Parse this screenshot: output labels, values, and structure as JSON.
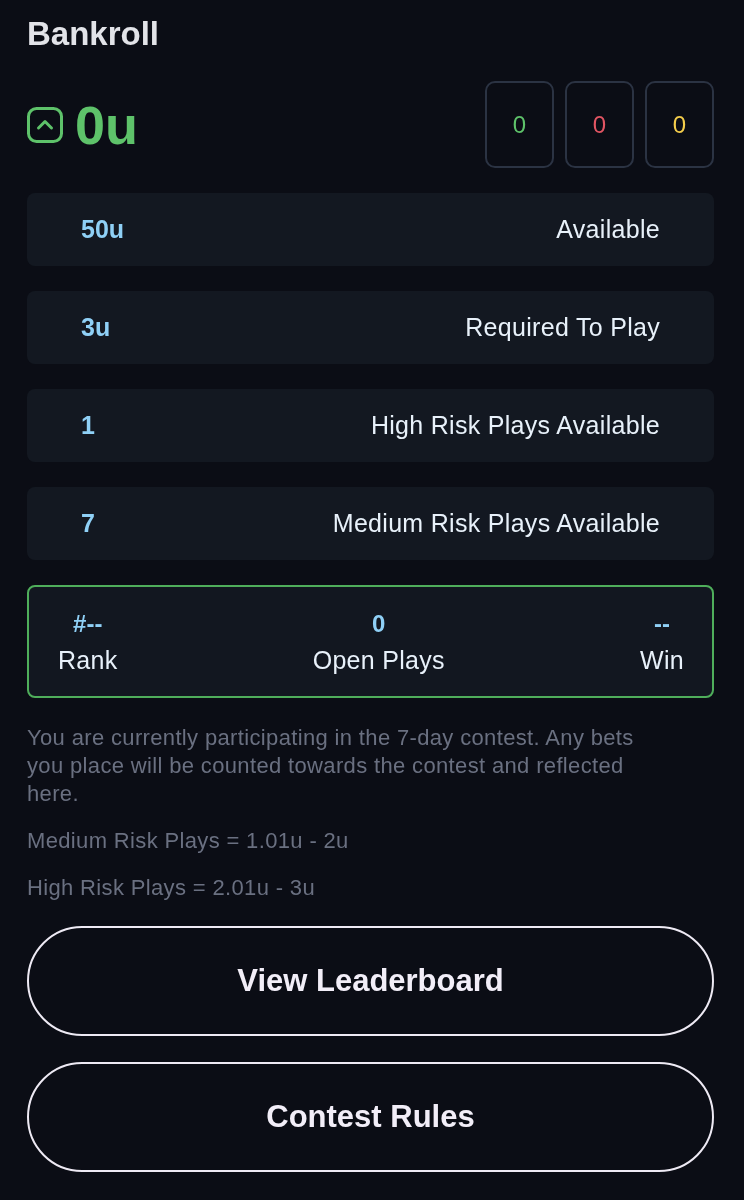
{
  "title": "Bankroll",
  "balance": {
    "value": "0u",
    "kind": "up"
  },
  "counters": [
    {
      "value": "0",
      "color": "#5ec26a"
    },
    {
      "value": "0",
      "color": "#e25563"
    },
    {
      "value": "0",
      "color": "#f4cd4b"
    }
  ],
  "stats": [
    {
      "value": "50u",
      "label": "Available"
    },
    {
      "value": "3u",
      "label": "Required To Play"
    },
    {
      "value": "1",
      "label": "High Risk Plays Available"
    },
    {
      "value": "7",
      "label": "Medium Risk Plays Available"
    }
  ],
  "summary": [
    {
      "value": "#--",
      "label": "Rank"
    },
    {
      "value": "0",
      "label": "Open Plays"
    },
    {
      "value": "--",
      "label": "Win"
    }
  ],
  "notes": [
    "You are currently participating in the 7-day contest. Any bets you place will be counted towards the contest and reflected here.",
    "Medium Risk Plays = 1.01u - 2u",
    "High Risk Plays = 2.01u - 3u"
  ],
  "buttons": [
    "View Leaderboard",
    "Contest Rules"
  ]
}
